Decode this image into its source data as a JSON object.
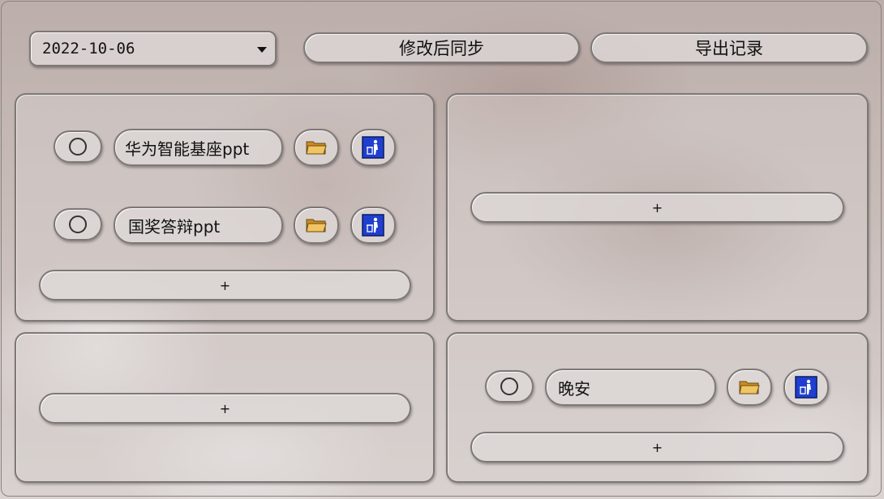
{
  "toolbar": {
    "date_value": "2022-10-06",
    "sync_label": "修改后同步",
    "export_label": "导出记录"
  },
  "panels": {
    "top_left": {
      "items": [
        {
          "name": "华为智能基座ppt"
        },
        {
          "name": "国奖答辩ppt"
        }
      ],
      "add_label": "+"
    },
    "top_right": {
      "items": [],
      "add_label": "+"
    },
    "bottom_left": {
      "items": [],
      "add_label": "+"
    },
    "bottom_right": {
      "items": [
        {
          "name": "晚安"
        }
      ],
      "add_label": "+"
    }
  },
  "icons": {
    "radio": "radio-circle-icon",
    "folder": "folder-icon",
    "trash": "trash-icon"
  },
  "colors": {
    "trash_blue": "#1f3fd0",
    "folder_yellow": "#e6b24a"
  }
}
